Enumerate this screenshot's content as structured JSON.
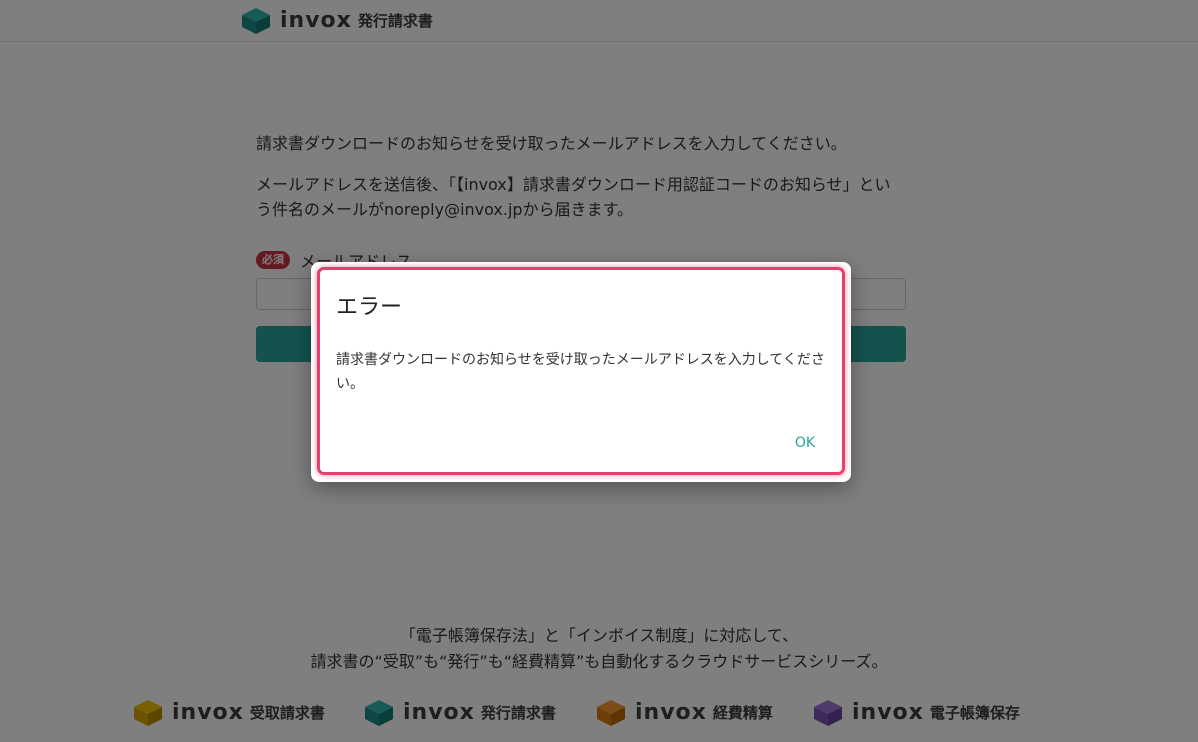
{
  "header": {
    "brand": "invox",
    "product": "発行請求書",
    "brand_color": "#1e9e95"
  },
  "main": {
    "intro": "請求書ダウンロードのお知らせを受け取ったメールアドレスを入力してください。",
    "note": "メールアドレスを送信後、「【invox】請求書ダウンロード用認証コードのお知らせ」という件名のメールがnoreply@invox.jpから届きます。",
    "required_badge": "必須",
    "email_label": "メールアドレス",
    "email_value": "",
    "accent_color": "#2aa59a"
  },
  "footer": {
    "line1": "「電子帳簿保存法」と「インボイス制度」に対応して、",
    "line2": "請求書の“受取”も“発行”も“経費精算”も自動化するクラウドサービスシリーズ。",
    "products": [
      {
        "brand": "invox",
        "name": "受取請求書",
        "color": "#e6b400"
      },
      {
        "brand": "invox",
        "name": "発行請求書",
        "color": "#1e9e95"
      },
      {
        "brand": "invox",
        "name": "経費精算",
        "color": "#e88a1a"
      },
      {
        "brand": "invox",
        "name": "電子帳簿保存",
        "color": "#8a5ec2"
      }
    ]
  },
  "dialog": {
    "title": "エラー",
    "message": "請求書ダウンロードのお知らせを受け取ったメールアドレスを入力してください。",
    "ok_label": "OK",
    "highlight_color": "#ea3f6e"
  }
}
